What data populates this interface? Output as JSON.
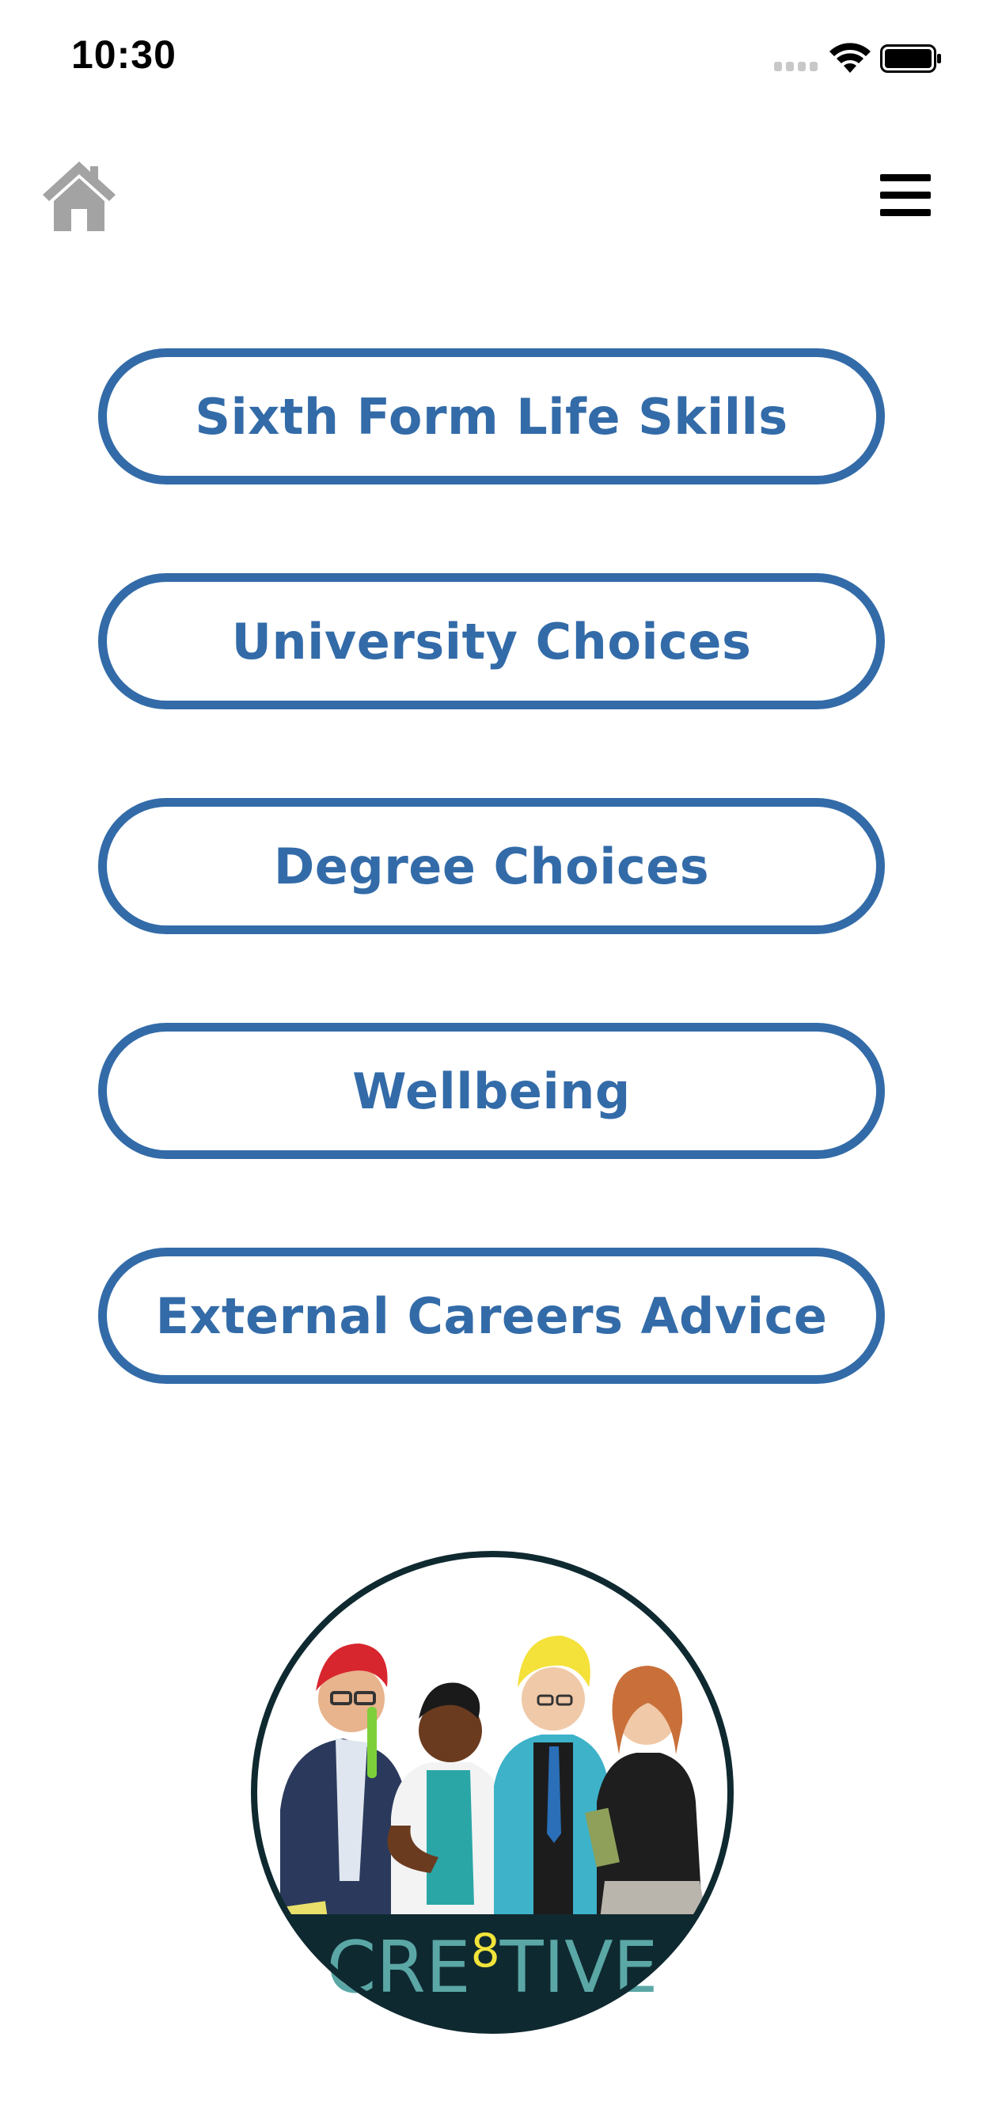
{
  "status_bar": {
    "time": "10:30"
  },
  "nav": {
    "home_icon": "home-icon",
    "menu_icon": "hamburger-menu-icon"
  },
  "menu_buttons": [
    {
      "label": "Sixth Form Life Skills"
    },
    {
      "label": "University Choices"
    },
    {
      "label": "Degree Choices"
    },
    {
      "label": "Wellbeing"
    },
    {
      "label": "External Careers Advice"
    }
  ],
  "logo": {
    "text_prefix": "CRE",
    "text_superscript": "8",
    "text_suffix": "TIVE"
  },
  "colors": {
    "accent": "#336ba8",
    "home_icon": "#a3a3a3",
    "logo_dark": "#0f2930",
    "logo_teal": "#5aa7a6",
    "logo_yellow": "#f1e43a"
  }
}
